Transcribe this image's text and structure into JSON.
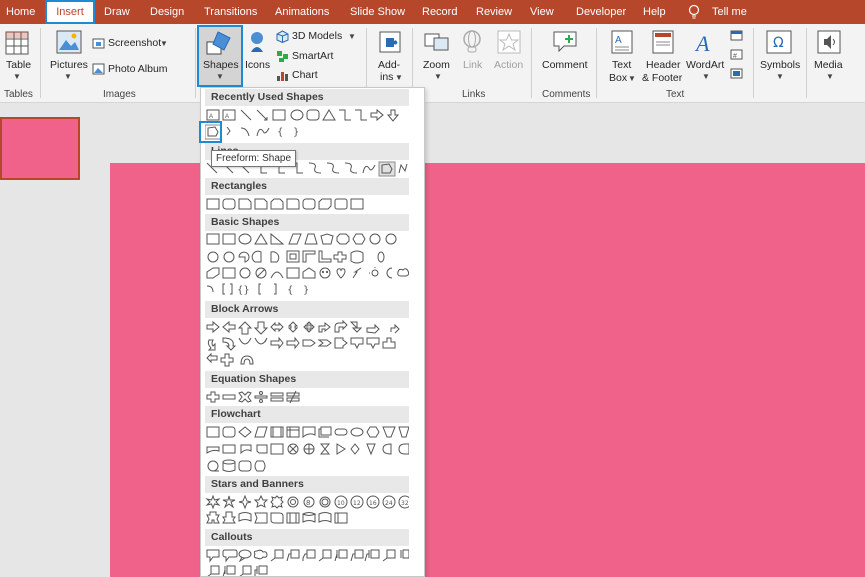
{
  "tabs": [
    "Home",
    "Insert",
    "Draw",
    "Design",
    "Transitions",
    "Animations",
    "Slide Show",
    "Record",
    "Review",
    "View",
    "Developer",
    "Help"
  ],
  "tell_me": "Tell me",
  "ribbon": {
    "table": "Table",
    "pictures": "Pictures",
    "screenshot": "Screenshot",
    "photo_album": "Photo Album",
    "shapes": "Shapes",
    "icons": "Icons",
    "models_3d": "3D Models",
    "smartart": "SmartArt",
    "chart": "Chart",
    "addins_1": "Add-",
    "addins_2": "ins",
    "zoom": "Zoom",
    "link": "Link",
    "action": "Action",
    "comment": "Comment",
    "textbox_1": "Text",
    "textbox_2": "Box",
    "header_1": "Header",
    "header_2": "& Footer",
    "wordart": "WordArt",
    "symbols": "Symbols",
    "media": "Media"
  },
  "groups": {
    "tables": "Tables",
    "images": "Images",
    "links": "Links",
    "comments": "Comments",
    "text": "Text"
  },
  "gallery": {
    "sections": [
      "Recently Used Shapes",
      "Lines",
      "Rectangles",
      "Basic Shapes",
      "Block Arrows",
      "Equation Shapes",
      "Flowchart",
      "Stars and Banners",
      "Callouts"
    ],
    "tooltip": "Freeform: Shape"
  },
  "colors": {
    "accent": "#b7472a",
    "highlight": "#1e8ad3",
    "slide": "#f1628b"
  }
}
